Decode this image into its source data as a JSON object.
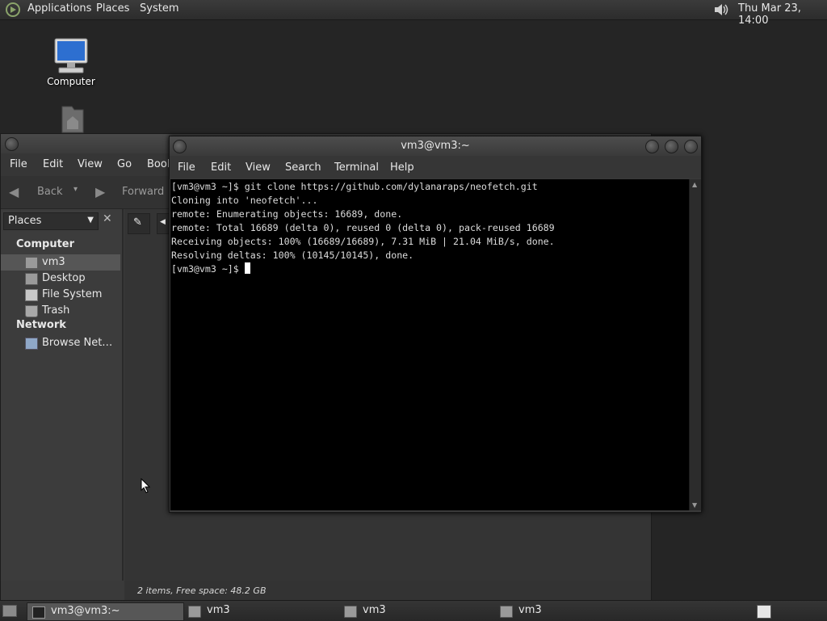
{
  "top_panel": {
    "menus": [
      "Applications",
      "Places",
      "System"
    ],
    "clock": "Thu Mar 23, 14:00"
  },
  "desktop": {
    "icons": [
      {
        "label": "Computer"
      },
      {
        "label": ""
      }
    ]
  },
  "file_manager": {
    "menus": [
      "File",
      "Edit",
      "View",
      "Go",
      "Book"
    ],
    "toolbar": {
      "back": "Back",
      "forward": "Forward"
    },
    "sidebar": {
      "selector": "Places",
      "sections": [
        {
          "heading": "Computer",
          "items": [
            "vm3",
            "Desktop",
            "File System",
            "Trash"
          ]
        },
        {
          "heading": "Network",
          "items": [
            "Browse Net…"
          ]
        }
      ]
    },
    "status": "2 items, Free space: 48.2 GB"
  },
  "terminal": {
    "title": "vm3@vm3:~",
    "menus": [
      "File",
      "Edit",
      "View",
      "Search",
      "Terminal",
      "Help"
    ],
    "lines": [
      "[vm3@vm3 ~]$ git clone https://github.com/dylanaraps/neofetch.git",
      "Cloning into 'neofetch'...",
      "remote: Enumerating objects: 16689, done.",
      "remote: Total 16689 (delta 0), reused 0 (delta 0), pack-reused 16689",
      "Receiving objects: 100% (16689/16689), 7.31 MiB | 21.04 MiB/s, done.",
      "Resolving deltas: 100% (10145/10145), done."
    ],
    "prompt": "[vm3@vm3 ~]$ "
  },
  "taskbar": {
    "tasks": [
      {
        "label": "vm3@vm3:~",
        "active": true
      },
      {
        "label": "vm3",
        "active": false
      },
      {
        "label": "vm3",
        "active": false
      },
      {
        "label": "vm3",
        "active": false
      }
    ]
  }
}
